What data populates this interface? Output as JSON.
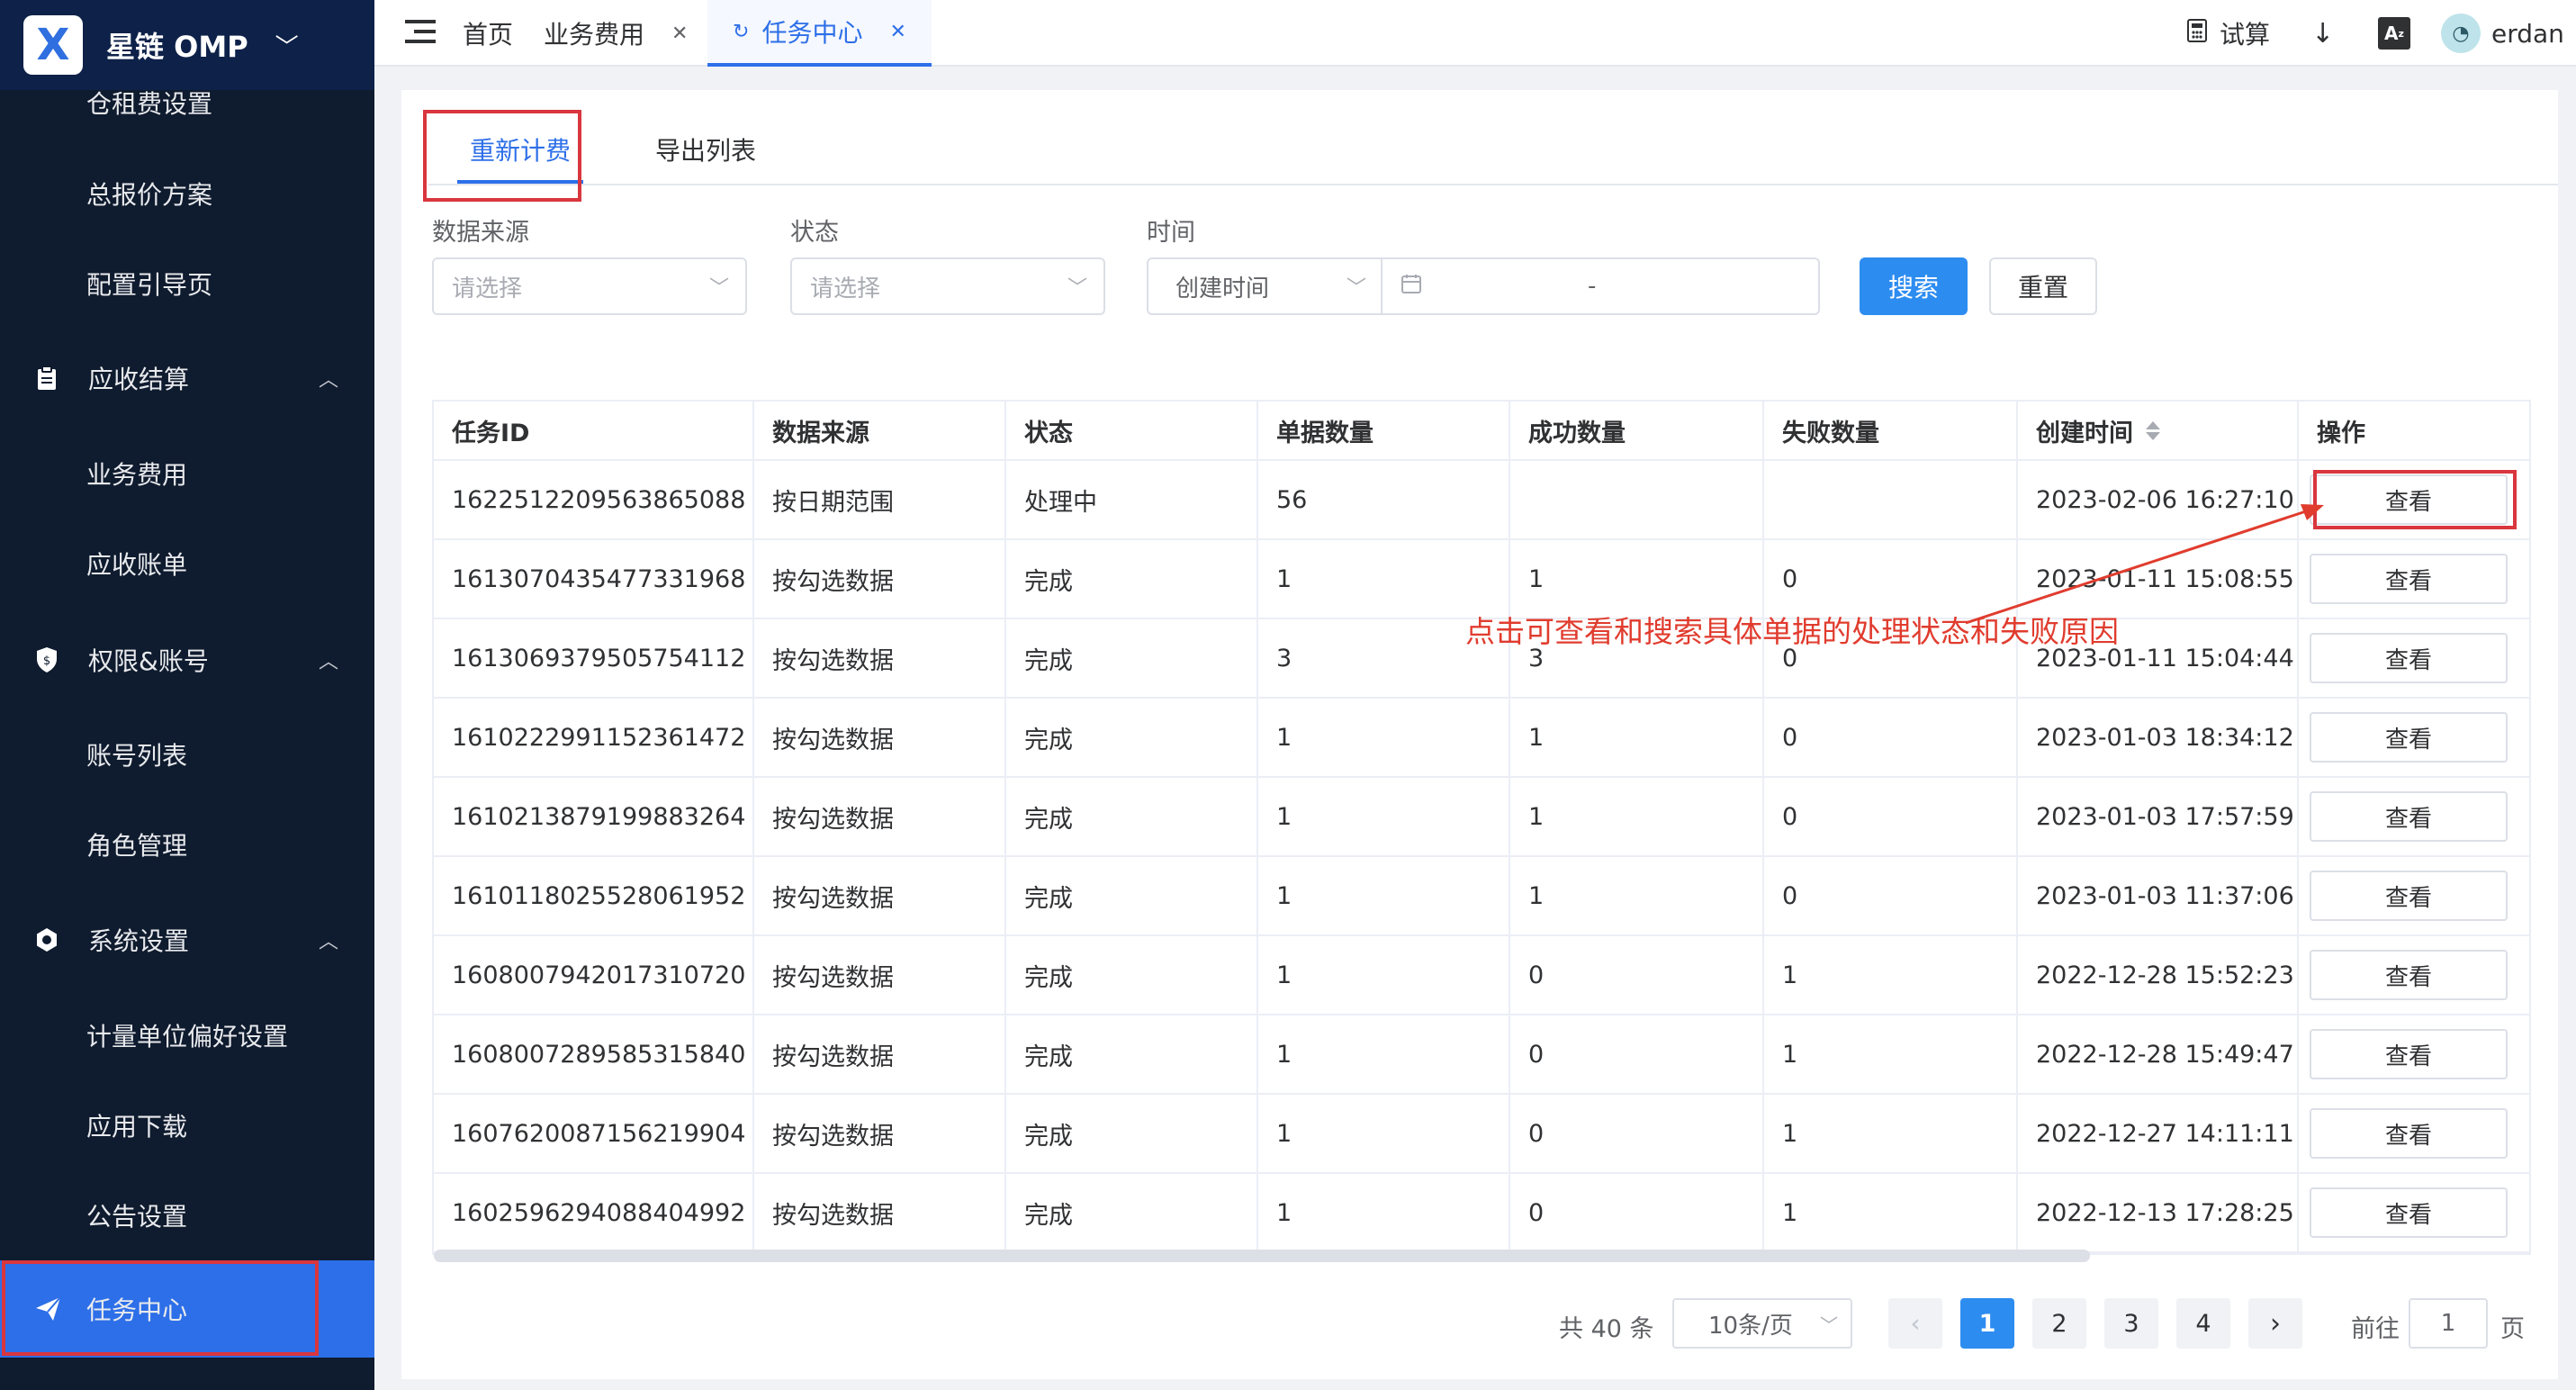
{
  "brand": {
    "logo_text": "X",
    "name": "星链   OMP"
  },
  "sidebar": {
    "items": [
      {
        "label": "仓租费设置"
      },
      {
        "label": "总报价方案"
      },
      {
        "label": "配置引导页"
      },
      {
        "label": "应收结算",
        "icon": "clipboard-icon"
      },
      {
        "label": "业务费用"
      },
      {
        "label": "应收账单"
      },
      {
        "label": "权限&账号",
        "icon": "shield-icon"
      },
      {
        "label": "账号列表"
      },
      {
        "label": "角色管理"
      },
      {
        "label": "系统设置",
        "icon": "gear-icon"
      },
      {
        "label": "计量单位偏好设置"
      },
      {
        "label": "应用下载"
      },
      {
        "label": "公告设置"
      },
      {
        "label": "任务中心",
        "icon": "send-icon"
      }
    ],
    "active_color": "#2d6fe8",
    "background": "#0f1b2e"
  },
  "topbar": {
    "tabs": [
      {
        "label": "首页"
      },
      {
        "label": "业务费用"
      },
      {
        "label": "任务中心"
      }
    ],
    "calc_label": "试算",
    "user_name": "erdan"
  },
  "page_tabs": {
    "recalc": "重新计费",
    "export": "导出列表"
  },
  "filters": {
    "source_label": "数据来源",
    "source_placeholder": "请选择",
    "status_label": "状态",
    "status_placeholder": "请选择",
    "time_label": "时间",
    "time_type": "创建时间",
    "range_sep": "-",
    "search_btn": "搜索",
    "reset_btn": "重置"
  },
  "table": {
    "headers": [
      "任务ID",
      "数据来源",
      "状态",
      "单据数量",
      "成功数量",
      "失败数量",
      "创建时间",
      "操作"
    ],
    "action_label": "查看",
    "rows": [
      [
        "1622512209563865088",
        "按日期范围",
        "处理中",
        "56",
        "",
        "",
        "2023-02-06 16:27:10"
      ],
      [
        "1613070435477331968",
        "按勾选数据",
        "完成",
        "1",
        "1",
        "0",
        "2023-01-11 15:08:55"
      ],
      [
        "1613069379505754112",
        "按勾选数据",
        "完成",
        "3",
        "3",
        "0",
        "2023-01-11 15:04:44"
      ],
      [
        "1610222991152361472",
        "按勾选数据",
        "完成",
        "1",
        "1",
        "0",
        "2023-01-03 18:34:12"
      ],
      [
        "1610213879199883264",
        "按勾选数据",
        "完成",
        "1",
        "1",
        "0",
        "2023-01-03 17:57:59"
      ],
      [
        "1610118025528061952",
        "按勾选数据",
        "完成",
        "1",
        "1",
        "0",
        "2023-01-03 11:37:06"
      ],
      [
        "1608007942017310720",
        "按勾选数据",
        "完成",
        "1",
        "0",
        "1",
        "2022-12-28 15:52:23"
      ],
      [
        "1608007289585315840",
        "按勾选数据",
        "完成",
        "1",
        "0",
        "1",
        "2022-12-28 15:49:47"
      ],
      [
        "1607620087156219904",
        "按勾选数据",
        "完成",
        "1",
        "0",
        "1",
        "2022-12-27 14:11:11"
      ],
      [
        "1602596294088404992",
        "按勾选数据",
        "完成",
        "1",
        "0",
        "1",
        "2022-12-13 17:28:25"
      ]
    ]
  },
  "annotation": {
    "text": "点击可查看和搜索具体单据的处理状态和失败原因",
    "color": "#e03c2e"
  },
  "pagination": {
    "total": "共 40 条",
    "page_size": "10条/页",
    "pages": [
      "1",
      "2",
      "3",
      "4"
    ],
    "current": "1",
    "goto_prefix": "前往",
    "goto_value": "1",
    "goto_suffix": "页"
  },
  "colors": {
    "primary": "#2d8cf0",
    "highlight_red": "#d9363e"
  }
}
